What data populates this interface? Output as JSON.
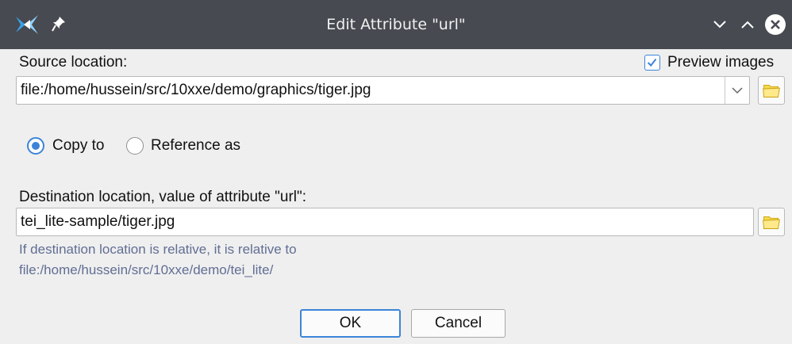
{
  "window": {
    "title": "Edit Attribute \"url\"",
    "icons": [
      "app-icon",
      "pin-icon",
      "minimize-icon",
      "maximize-icon",
      "close-icon"
    ]
  },
  "source": {
    "label": "Source location:",
    "value": "file:/home/hussein/src/10xxe/demo/graphics/tiger.jpg"
  },
  "preview": {
    "label": "Preview images",
    "checked": true
  },
  "mode": {
    "copy_label": "Copy to",
    "reference_label": "Reference as",
    "selected": "Copy to"
  },
  "destination": {
    "label": "Destination location, value of attribute \"url\":",
    "value": "tei_lite-sample/tiger.jpg",
    "hint_line1": "If destination location is relative, it is relative to",
    "hint_line2": "file:/home/hussein/src/10xxe/demo/tei_lite/"
  },
  "buttons": {
    "ok": "OK",
    "cancel": "Cancel"
  },
  "colors": {
    "titlebar": "#474a50",
    "accent": "#3d84d8",
    "hint": "#616e94",
    "background": "#efefef"
  }
}
